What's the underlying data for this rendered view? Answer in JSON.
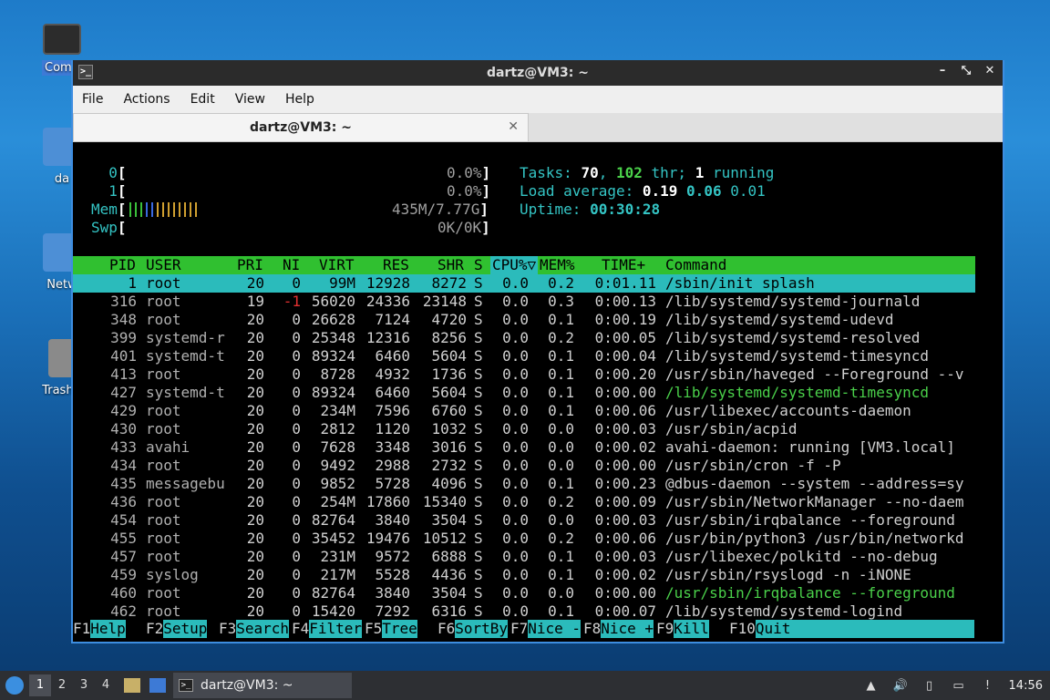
{
  "desktop": {
    "icons": [
      {
        "label": "Comp",
        "icon": "computer-icon"
      },
      {
        "label": "da",
        "icon": "home-folder-icon"
      },
      {
        "label": "Netw",
        "icon": "network-icon"
      },
      {
        "label": "Trash (",
        "icon": "trash-icon"
      }
    ]
  },
  "window": {
    "title": "dartz@VM3: ~",
    "menu": [
      "File",
      "Actions",
      "Edit",
      "View",
      "Help"
    ],
    "tab_title": "dartz@VM3: ~",
    "controls": {
      "minimize": "–",
      "maximize": "⤡",
      "close": "✕"
    }
  },
  "htop": {
    "cpu0": {
      "label": "0",
      "value": "0.0%"
    },
    "cpu1": {
      "label": "1",
      "value": "0.0%"
    },
    "mem": {
      "label": "Mem",
      "value": "435M/7.77G"
    },
    "swp": {
      "label": "Swp",
      "value": "0K/0K"
    },
    "tasks": {
      "label": "Tasks:",
      "count": "70",
      "thr": "102",
      "thr_label": "thr;",
      "running": "1",
      "running_label": "running"
    },
    "load": {
      "label": "Load average:",
      "v1": "0.19",
      "v5": "0.06",
      "v15": "0.01"
    },
    "uptime": {
      "label": "Uptime:",
      "value": "00:30:28"
    },
    "columns": [
      "PID",
      "USER",
      "PRI",
      "NI",
      "VIRT",
      "RES",
      "SHR",
      "S",
      "CPU%▽",
      "MEM%",
      "TIME+",
      "Command"
    ],
    "processes": [
      {
        "pid": "1",
        "user": "root",
        "pri": "20",
        "ni": "0",
        "virt": "99M",
        "res": "12928",
        "shr": "8272",
        "s": "S",
        "cpu": "0.0",
        "mem": "0.2",
        "time": "0:01.11",
        "cmd": "/sbin/init splash"
      },
      {
        "pid": "316",
        "user": "root",
        "pri": "19",
        "ni": "-1",
        "virt": "56020",
        "res": "24336",
        "shr": "23148",
        "s": "S",
        "cpu": "0.0",
        "mem": "0.3",
        "time": "0:00.13",
        "cmd": "/lib/systemd/systemd-journald"
      },
      {
        "pid": "348",
        "user": "root",
        "pri": "20",
        "ni": "0",
        "virt": "26628",
        "res": "7124",
        "shr": "4720",
        "s": "S",
        "cpu": "0.0",
        "mem": "0.1",
        "time": "0:00.19",
        "cmd": "/lib/systemd/systemd-udevd"
      },
      {
        "pid": "399",
        "user": "systemd-r",
        "pri": "20",
        "ni": "0",
        "virt": "25348",
        "res": "12316",
        "shr": "8256",
        "s": "S",
        "cpu": "0.0",
        "mem": "0.2",
        "time": "0:00.05",
        "cmd": "/lib/systemd/systemd-resolved"
      },
      {
        "pid": "401",
        "user": "systemd-t",
        "pri": "20",
        "ni": "0",
        "virt": "89324",
        "res": "6460",
        "shr": "5604",
        "s": "S",
        "cpu": "0.0",
        "mem": "0.1",
        "time": "0:00.04",
        "cmd": "/lib/systemd/systemd-timesyncd"
      },
      {
        "pid": "413",
        "user": "root",
        "pri": "20",
        "ni": "0",
        "virt": "8728",
        "res": "4932",
        "shr": "1736",
        "s": "S",
        "cpu": "0.0",
        "mem": "0.1",
        "time": "0:00.20",
        "cmd": "/usr/sbin/haveged --Foreground --v"
      },
      {
        "pid": "427",
        "user": "systemd-t",
        "pri": "20",
        "ni": "0",
        "virt": "89324",
        "res": "6460",
        "shr": "5604",
        "s": "S",
        "cpu": "0.0",
        "mem": "0.1",
        "time": "0:00.00",
        "cmd": "/lib/systemd/systemd-timesyncd"
      },
      {
        "pid": "429",
        "user": "root",
        "pri": "20",
        "ni": "0",
        "virt": "234M",
        "res": "7596",
        "shr": "6760",
        "s": "S",
        "cpu": "0.0",
        "mem": "0.1",
        "time": "0:00.06",
        "cmd": "/usr/libexec/accounts-daemon"
      },
      {
        "pid": "430",
        "user": "root",
        "pri": "20",
        "ni": "0",
        "virt": "2812",
        "res": "1120",
        "shr": "1032",
        "s": "S",
        "cpu": "0.0",
        "mem": "0.0",
        "time": "0:00.03",
        "cmd": "/usr/sbin/acpid"
      },
      {
        "pid": "433",
        "user": "avahi",
        "pri": "20",
        "ni": "0",
        "virt": "7628",
        "res": "3348",
        "shr": "3016",
        "s": "S",
        "cpu": "0.0",
        "mem": "0.0",
        "time": "0:00.02",
        "cmd": "avahi-daemon: running [VM3.local]"
      },
      {
        "pid": "434",
        "user": "root",
        "pri": "20",
        "ni": "0",
        "virt": "9492",
        "res": "2988",
        "shr": "2732",
        "s": "S",
        "cpu": "0.0",
        "mem": "0.0",
        "time": "0:00.00",
        "cmd": "/usr/sbin/cron -f -P"
      },
      {
        "pid": "435",
        "user": "messagebu",
        "pri": "20",
        "ni": "0",
        "virt": "9852",
        "res": "5728",
        "shr": "4096",
        "s": "S",
        "cpu": "0.0",
        "mem": "0.1",
        "time": "0:00.23",
        "cmd": "@dbus-daemon --system --address=sy"
      },
      {
        "pid": "436",
        "user": "root",
        "pri": "20",
        "ni": "0",
        "virt": "254M",
        "res": "17860",
        "shr": "15340",
        "s": "S",
        "cpu": "0.0",
        "mem": "0.2",
        "time": "0:00.09",
        "cmd": "/usr/sbin/NetworkManager --no-daem"
      },
      {
        "pid": "454",
        "user": "root",
        "pri": "20",
        "ni": "0",
        "virt": "82764",
        "res": "3840",
        "shr": "3504",
        "s": "S",
        "cpu": "0.0",
        "mem": "0.0",
        "time": "0:00.03",
        "cmd": "/usr/sbin/irqbalance --foreground"
      },
      {
        "pid": "455",
        "user": "root",
        "pri": "20",
        "ni": "0",
        "virt": "35452",
        "res": "19476",
        "shr": "10512",
        "s": "S",
        "cpu": "0.0",
        "mem": "0.2",
        "time": "0:00.06",
        "cmd": "/usr/bin/python3 /usr/bin/networkd"
      },
      {
        "pid": "457",
        "user": "root",
        "pri": "20",
        "ni": "0",
        "virt": "231M",
        "res": "9572",
        "shr": "6888",
        "s": "S",
        "cpu": "0.0",
        "mem": "0.1",
        "time": "0:00.03",
        "cmd": "/usr/libexec/polkitd --no-debug"
      },
      {
        "pid": "459",
        "user": "syslog",
        "pri": "20",
        "ni": "0",
        "virt": "217M",
        "res": "5528",
        "shr": "4436",
        "s": "S",
        "cpu": "0.0",
        "mem": "0.1",
        "time": "0:00.02",
        "cmd": "/usr/sbin/rsyslogd -n -iNONE"
      },
      {
        "pid": "460",
        "user": "root",
        "pri": "20",
        "ni": "0",
        "virt": "82764",
        "res": "3840",
        "shr": "3504",
        "s": "S",
        "cpu": "0.0",
        "mem": "0.0",
        "time": "0:00.00",
        "cmd": "/usr/sbin/irqbalance --foreground"
      },
      {
        "pid": "462",
        "user": "root",
        "pri": "20",
        "ni": "0",
        "virt": "15420",
        "res": "7292",
        "shr": "6316",
        "s": "S",
        "cpu": "0.0",
        "mem": "0.1",
        "time": "0:00.07",
        "cmd": "/lib/systemd/systemd-logind"
      }
    ],
    "thread_rows": [
      "427",
      "460"
    ],
    "fkeys": [
      {
        "k": "F1",
        "v": "Help  "
      },
      {
        "k": "F2",
        "v": "Setup "
      },
      {
        "k": "F3",
        "v": "Search"
      },
      {
        "k": "F4",
        "v": "Filter"
      },
      {
        "k": "F5",
        "v": "Tree  "
      },
      {
        "k": "F6",
        "v": "SortBy"
      },
      {
        "k": "F7",
        "v": "Nice -"
      },
      {
        "k": "F8",
        "v": "Nice +"
      },
      {
        "k": "F9",
        "v": "Kill  "
      },
      {
        "k": "F10",
        "v": "Quit"
      }
    ]
  },
  "taskbar": {
    "workspaces": [
      "1",
      "2",
      "3",
      "4"
    ],
    "active_workspace": "1",
    "task_label": "dartz@VM3: ~",
    "clock": "14:56"
  },
  "colors": {
    "accent": "#3d8de0",
    "htop_cyan": "#2bbbbb",
    "htop_green": "#30c030"
  }
}
